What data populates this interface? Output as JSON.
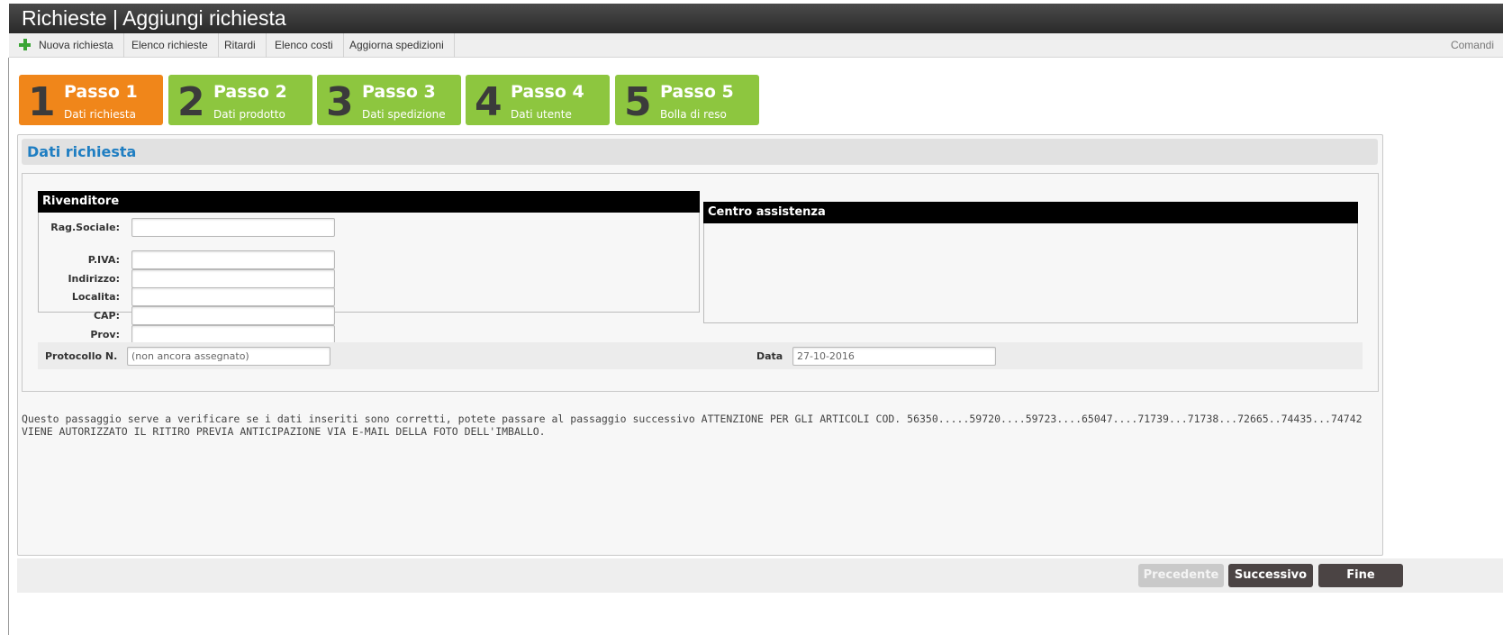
{
  "window": {
    "title": "Richieste | Aggiungi richiesta"
  },
  "toolbar": {
    "items": [
      "Nuova richiesta",
      "Elenco richieste",
      "Ritardi",
      "Elenco costi",
      "Aggiorna spedizioni"
    ],
    "right_label": "Comandi"
  },
  "steps": [
    {
      "num": "1",
      "title": "Passo 1",
      "subtitle": "Dati richiesta",
      "active": true
    },
    {
      "num": "2",
      "title": "Passo 2",
      "subtitle": "Dati prodotto",
      "active": false
    },
    {
      "num": "3",
      "title": "Passo 3",
      "subtitle": "Dati spedizione",
      "active": false
    },
    {
      "num": "4",
      "title": "Passo 4",
      "subtitle": "Dati utente",
      "active": false
    },
    {
      "num": "5",
      "title": "Passo 5",
      "subtitle": "Bolla di reso",
      "active": false
    }
  ],
  "section": {
    "title": "Dati richiesta"
  },
  "rivenditore": {
    "title": "Rivenditore",
    "fields": {
      "rag_sociale": {
        "label": "Rag.Sociale:",
        "value": ""
      },
      "piva": {
        "label": "P.IVA:",
        "value": ""
      },
      "indirizzo": {
        "label": "Indirizzo:",
        "value": ""
      },
      "localita": {
        "label": "Localita:",
        "value": ""
      },
      "cap": {
        "label": "CAP:",
        "value": ""
      },
      "prov": {
        "label": "Prov:",
        "value": ""
      }
    }
  },
  "centro": {
    "title": "Centro assistenza"
  },
  "protocollo": {
    "label": "Protocollo N.",
    "placeholder": "(non ancora assegnato)"
  },
  "data": {
    "label": "Data",
    "value": "27-10-2016"
  },
  "note": "Questo passaggio serve a verificare se i dati inseriti sono corretti, potete passare al passaggio successivo ATTENZIONE PER GLI ARTICOLI COD. 56350.....59720....59723....65047....71739...71738...72665..74435...74742 VIENE AUTORIZZATO IL RITIRO PREVIA ANTICIPAZIONE VIA E-MAIL DELLA FOTO DELL'IMBALLO.",
  "buttons": {
    "prev": "Precedente",
    "next": "Successivo",
    "finish": "Fine"
  },
  "colors": {
    "step_active": "#f0861a",
    "step_inactive": "#8dc63f",
    "accent": "#1f7ec2"
  }
}
